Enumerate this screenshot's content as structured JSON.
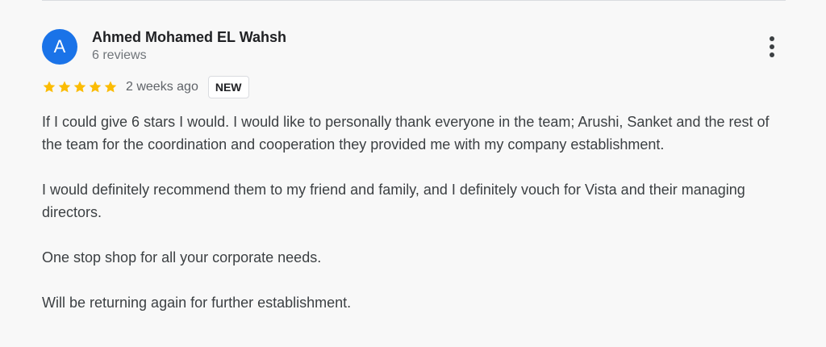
{
  "reviewer": {
    "avatar_initial": "A",
    "name": "Ahmed Mohamed EL Wahsh",
    "reviews": "6 reviews"
  },
  "rating": {
    "stars": 5,
    "max_stars": 5,
    "star_color": "#fbbc04",
    "time_ago": "2 weeks ago",
    "badge": "NEW"
  },
  "review": {
    "paragraphs": [
      "If I could give 6 stars I would. I would like to personally thank everyone in the team; Arushi, Sanket and the rest of the team for the coordination and cooperation they provided me with my company establishment.",
      "I would definitely recommend them to my friend and family, and I definitely vouch for Vista and their managing directors.",
      "One stop shop for all your corporate needs.",
      "Will be returning again for further establishment."
    ]
  },
  "icons": {
    "more": "more-vert-icon",
    "star": "star-icon"
  },
  "colors": {
    "avatar_bg": "#1a73e8",
    "background": "#f8f8f8"
  }
}
